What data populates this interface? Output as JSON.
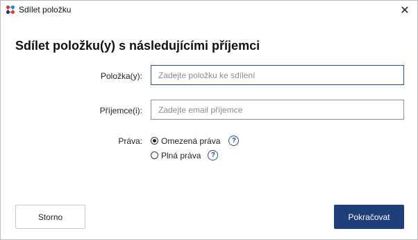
{
  "window": {
    "title": "Sdílet položku",
    "close_symbol": "✕"
  },
  "dialog": {
    "heading": "Sdílet položku(y) s následujícími příjemci",
    "item_label": "Položka(y):",
    "item_placeholder": "Zadejte položku ke sdílení",
    "recipient_label": "Příjemce(i):",
    "recipient_placeholder": "Zadejte email příjemce",
    "rights_label": "Práva:",
    "rights_options": [
      {
        "label": "Omezená práva",
        "selected": true
      },
      {
        "label": "Plná práva",
        "selected": false
      }
    ],
    "help_symbol": "?"
  },
  "buttons": {
    "cancel": "Storno",
    "continue": "Pokračovat"
  },
  "colors": {
    "accent": "#1f3f7a",
    "help_icon": "#1f4f96"
  },
  "icons": {
    "app": "app-logo-icon",
    "close": "close-icon",
    "help": "help-icon"
  }
}
